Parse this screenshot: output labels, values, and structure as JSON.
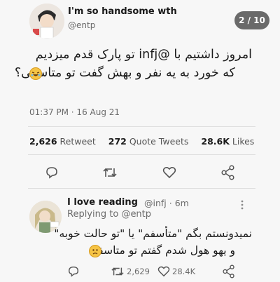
{
  "tweet": {
    "author_name": "I'm so handsome wth",
    "author_handle": "@entp",
    "text_line1": "امروز داشتیم با @infj تو پارک قدم میزدیم",
    "text_line2": "که خورد به یه نفر و بهش گفت تو متاسفی؟",
    "time": "01:37 PM · 16 Aug 21",
    "retweets": "2,626",
    "retweets_label": "Retweet",
    "quote_tweets": "272",
    "quote_tweets_label": "Quote Tweets",
    "likes": "28.6K",
    "likes_label": "Likes"
  },
  "slide_counter": "2 / 10",
  "reply": {
    "author_name": "I love reading",
    "author_handle": "@infj · 6m",
    "replying_label": "Replying to",
    "replying_to": "@entp",
    "text_line1": "نمیدونستم بگم \"متأسفم\" یا \"تو حالت خوبه\"",
    "text_line2": "و یهو هول شدم گفتم تو متاسفی",
    "retweets": "2,629",
    "likes": "28.4K"
  },
  "icons": {
    "reply": "reply-icon",
    "retweet": "retweet-icon",
    "like": "heart-icon",
    "share": "share-icon",
    "more": "more-icon",
    "emoji_laugh": "laughing-emoji",
    "emoji_sad": "sad-emoji"
  },
  "colors": {
    "counter_bg": "#6a6a6a",
    "background": "#f7f7f7"
  }
}
